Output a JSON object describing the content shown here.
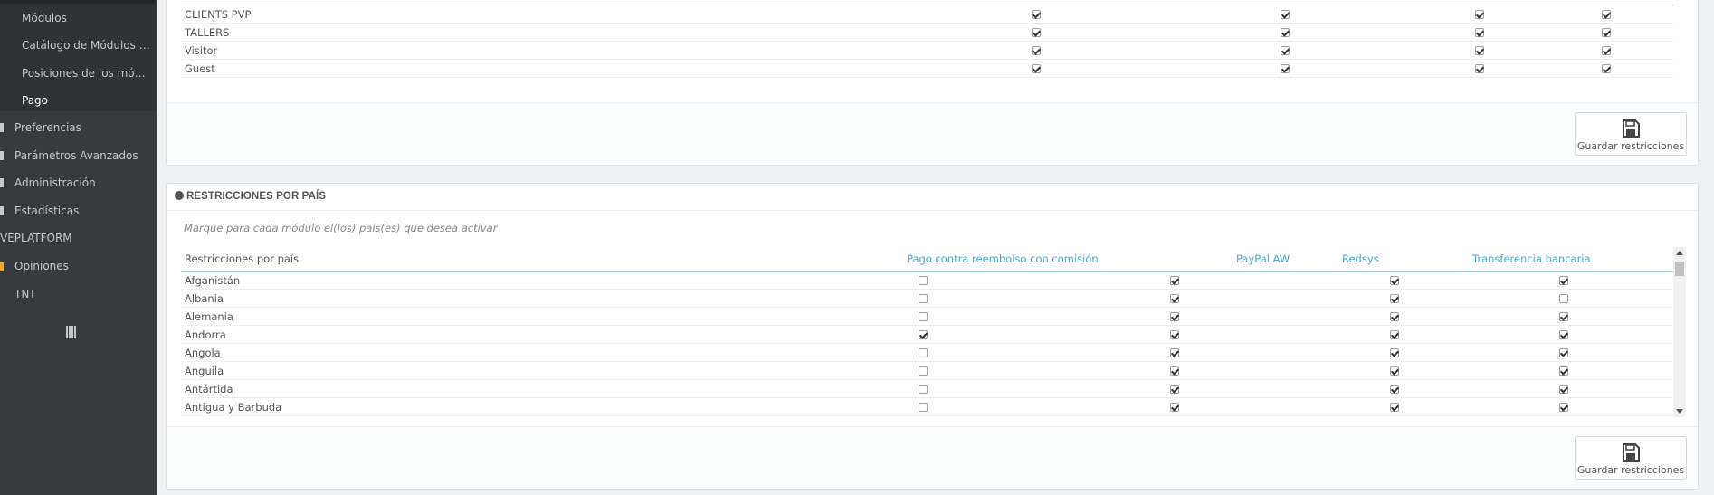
{
  "sidebar": {
    "sub_items": [
      {
        "label": "Módulos",
        "active": false
      },
      {
        "label": "Catálogo de Módulos y Te…",
        "active": false
      },
      {
        "label": "Posiciones de los módulos",
        "active": false
      },
      {
        "label": "Pago",
        "active": true
      }
    ],
    "main_items": [
      {
        "label": "Preferencias",
        "accent": "#c5c9ce"
      },
      {
        "label": "Parámetros Avanzados",
        "accent": "#c5c9ce"
      },
      {
        "label": "Administración",
        "accent": "#c5c9ce"
      },
      {
        "label": "Estadísticas",
        "accent": "#c5c9ce"
      },
      {
        "label": "VEPLATFORM",
        "accent": "#363a41"
      },
      {
        "label": "Opiniones",
        "accent": "#f5a623"
      },
      {
        "label": "TNT",
        "accent": "#363a41"
      }
    ],
    "toggle_icon": "menu-collapse-icon"
  },
  "group_panel": {
    "rows": [
      {
        "name": "CLIENTS PVP",
        "checks": [
          true,
          true,
          true,
          true
        ]
      },
      {
        "name": "TALLERS",
        "checks": [
          true,
          true,
          true,
          true
        ]
      },
      {
        "name": "Visitor",
        "checks": [
          true,
          true,
          true,
          true
        ]
      },
      {
        "name": "Guest",
        "checks": [
          true,
          true,
          true,
          true
        ]
      }
    ],
    "save_label": "Guardar restricciones"
  },
  "country_panel": {
    "title": "RESTRICCIONES POR PAÍS",
    "help": "Marque para cada módulo el(los) país(es) que desea activar",
    "columns": {
      "name": "Restricciones por país",
      "m1": "Pago contra reembolso con comisión",
      "m2": "PayPal AW",
      "m3": "Redsys",
      "m4": "Transferencia bancaria"
    },
    "rows": [
      {
        "name": "Afganistán",
        "checks": [
          false,
          true,
          true,
          true
        ]
      },
      {
        "name": "Albania",
        "checks": [
          false,
          true,
          true,
          false
        ]
      },
      {
        "name": "Alemania",
        "checks": [
          false,
          true,
          true,
          true
        ]
      },
      {
        "name": "Andorra",
        "checks": [
          true,
          true,
          true,
          true
        ]
      },
      {
        "name": "Angola",
        "checks": [
          false,
          true,
          true,
          true
        ]
      },
      {
        "name": "Anguila",
        "checks": [
          false,
          true,
          true,
          true
        ]
      },
      {
        "name": "Antártida",
        "checks": [
          false,
          true,
          true,
          true
        ]
      },
      {
        "name": "Antigua y Barbuda",
        "checks": [
          false,
          true,
          true,
          true
        ]
      }
    ],
    "save_label": "Guardar restricciones"
  }
}
